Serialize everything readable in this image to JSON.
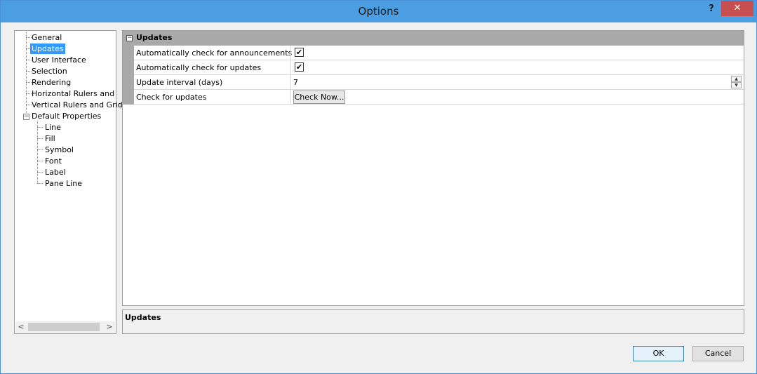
{
  "window": {
    "title": "Options",
    "help_label": "?",
    "close_label": "✕"
  },
  "tree": {
    "items": [
      {
        "label": "General",
        "selected": false
      },
      {
        "label": "Updates",
        "selected": true
      },
      {
        "label": "User Interface",
        "selected": false
      },
      {
        "label": "Selection",
        "selected": false
      },
      {
        "label": "Rendering",
        "selected": false
      },
      {
        "label": "Horizontal Rulers and Gri",
        "selected": false
      },
      {
        "label": "Vertical Rulers and Grid",
        "selected": false
      },
      {
        "label": "Default Properties",
        "selected": false
      }
    ],
    "default_properties_expander": "−",
    "children": [
      {
        "label": "Line"
      },
      {
        "label": "Fill"
      },
      {
        "label": "Symbol"
      },
      {
        "label": "Font"
      },
      {
        "label": "Label"
      },
      {
        "label": "Pane Line"
      }
    ],
    "scroll_left": "<",
    "scroll_right": ">"
  },
  "property_grid": {
    "category_label": "Updates",
    "category_expander": "−",
    "rows": [
      {
        "name": "Automatically check for announcements",
        "type": "checkbox",
        "checked": true,
        "check_glyph": "✔"
      },
      {
        "name": "Automatically check for updates",
        "type": "checkbox",
        "checked": true,
        "check_glyph": "✔"
      },
      {
        "name": "Update interval (days)",
        "type": "number",
        "value": "7"
      },
      {
        "name": "Check for updates",
        "type": "button",
        "button_label": "Check Now..."
      }
    ],
    "spin_up": "▲",
    "spin_down": "▼"
  },
  "description": {
    "title": "Updates"
  },
  "buttons": {
    "ok_label": "OK",
    "cancel_label": "Cancel"
  },
  "colors": {
    "titlebar": "#4c9ee2",
    "close": "#c74f4f",
    "selection": "#3399ff",
    "category": "#a9a9a9"
  }
}
